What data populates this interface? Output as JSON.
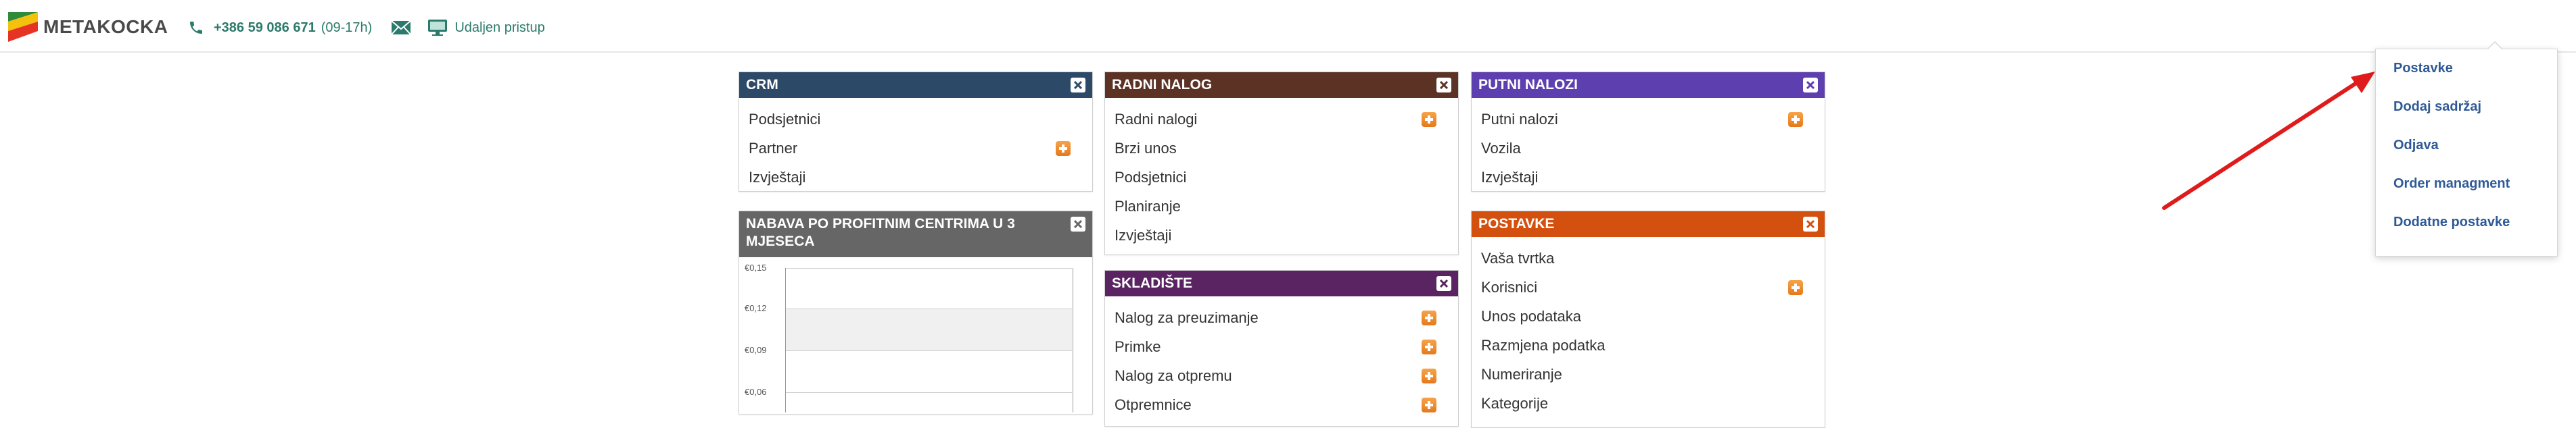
{
  "header": {
    "logo_text": "METAKOCKA",
    "phone": "+386 59 086 671",
    "hours": "(09-17h)",
    "remote_label": "Udaljen pristup"
  },
  "widgets": {
    "crm": {
      "title": "CRM",
      "color": "#2c4a68",
      "items": [
        "Podsjetnici",
        "Partner",
        "Izvještaji"
      ]
    },
    "radni_nalog": {
      "title": "RADNI NALOG",
      "color": "#5c3225",
      "items": [
        "Radni nalogi",
        "Brzi unos",
        "Podsjetnici",
        "Planiranje",
        "Izvještaji"
      ]
    },
    "putni_nalozi": {
      "title": "PUTNI NALOZI",
      "color": "#5e3fb0",
      "items": [
        "Putni nalozi",
        "Vozila",
        "Izvještaji"
      ]
    },
    "nabava": {
      "title": "NABAVA PO PROFITNIM CENTRIMA U 3 MJESECA",
      "color": "#666666",
      "y_ticks": [
        "€0,15",
        "€0,12",
        "€0,09",
        "€0,06"
      ]
    },
    "skladiste": {
      "title": "SKLADIŠTE",
      "color": "#5a2463",
      "items": [
        "Nalog za preuzimanje",
        "Primke",
        "Nalog za otpremu",
        "Otpremnice"
      ]
    },
    "postavke": {
      "title": "POSTAVKE",
      "color": "#d4500f",
      "items": [
        "Vaša tvrtka",
        "Korisnici",
        "Unos podataka",
        "Razmjena podatka",
        "Numeriranje",
        "Kategorije"
      ]
    }
  },
  "dropdown": {
    "items": [
      "Postavke",
      "Dodaj sadržaj",
      "Odjava",
      "Order managment",
      "Dodatne postavke"
    ]
  },
  "colors": {
    "accent_link": "#2f5a97",
    "header_text": "#2c7a6b",
    "plus_orange": "#e5791c",
    "arrow_red": "#e01b1b"
  }
}
